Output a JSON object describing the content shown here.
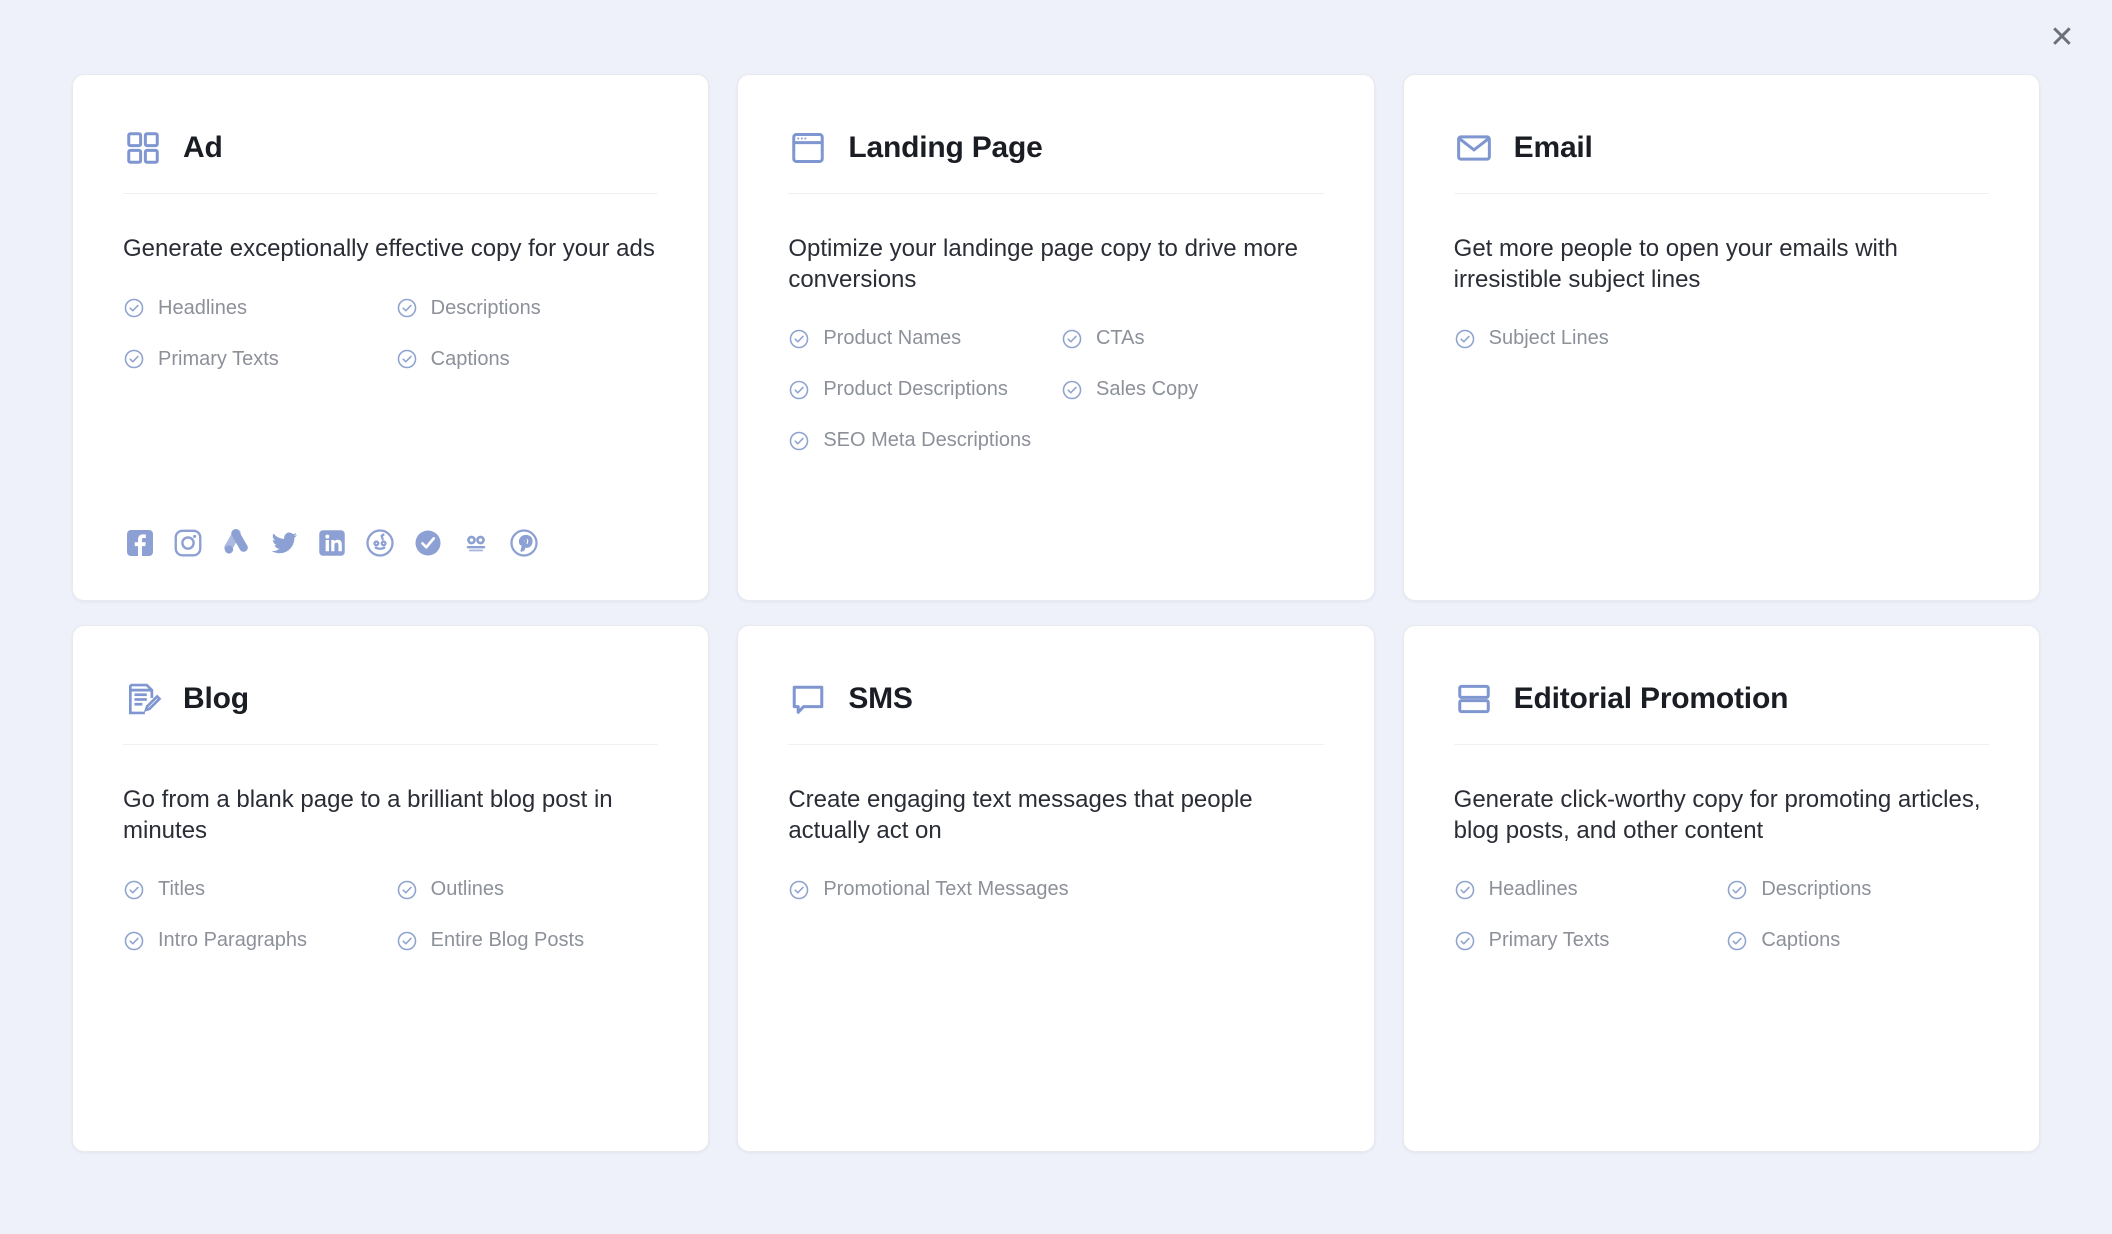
{
  "close_label": "✕",
  "colors": {
    "background": "#eef1fa",
    "card": "#ffffff",
    "icon_blue": "#7f96d1",
    "check_blue": "#8fa3cf",
    "title": "#1b1d24",
    "feature_text": "#8c9099"
  },
  "cards": [
    {
      "id": "ad",
      "icon": "grid-2x2-icon",
      "title": "Ad",
      "description": "Generate exceptionally effective copy for your ads",
      "features": [
        "Headlines",
        "Descriptions",
        "Primary Texts",
        "Captions"
      ],
      "socials": [
        "facebook-icon",
        "instagram-icon",
        "google-ads-icon",
        "twitter-icon",
        "linkedin-icon",
        "reddit-icon",
        "quora-icon",
        "snapchat-icon",
        "pinterest-icon"
      ]
    },
    {
      "id": "landing-page",
      "icon": "browser-window-icon",
      "title": "Landing Page",
      "description": "Optimize your landinge page copy to drive more conversions",
      "features": [
        "Product Names",
        "CTAs",
        "Product Descriptions",
        "Sales Copy",
        "SEO Meta Descriptions"
      ],
      "socials": []
    },
    {
      "id": "email",
      "icon": "envelope-icon",
      "title": "Email",
      "description": "Get more people to open your emails with irresistible subject lines",
      "features": [
        "Subject Lines"
      ],
      "socials": []
    },
    {
      "id": "blog",
      "icon": "document-pencil-icon",
      "title": "Blog",
      "description": "Go from a blank page to a brilliant blog post in minutes",
      "features": [
        "Titles",
        "Outlines",
        "Intro Paragraphs",
        "Entire Blog Posts"
      ],
      "socials": []
    },
    {
      "id": "sms",
      "icon": "speech-bubble-icon",
      "title": "SMS",
      "description": "Create engaging text messages that people actually act on",
      "features": [
        "Promotional Text Messages"
      ],
      "socials": []
    },
    {
      "id": "editorial-promotion",
      "icon": "stacked-rows-icon",
      "title": "Editorial Promotion",
      "description": "Generate click-worthy copy for promoting articles, blog posts, and other content",
      "features": [
        "Headlines",
        "Descriptions",
        "Primary Texts",
        "Captions"
      ],
      "socials": []
    }
  ]
}
